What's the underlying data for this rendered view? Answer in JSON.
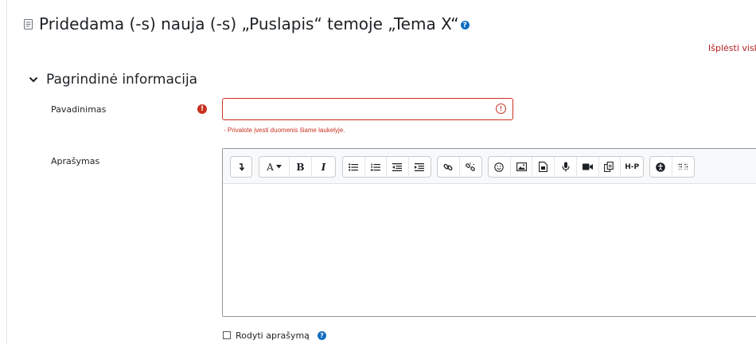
{
  "page": {
    "title": "Pridedama (-s) nauja (-s) „Puslapis“ temoje „Tema X“",
    "help_glyph": "?"
  },
  "expand_all": "Išplėsti visk",
  "section": {
    "title": "Pagrindinė informacija"
  },
  "name_field": {
    "label": "Pavadinimas",
    "required_glyph": "!",
    "value": "",
    "placeholder": "",
    "error_glyph": "!",
    "error_text": "- Privalote įvesti duomenis šiame laukelyje."
  },
  "description_field": {
    "label": "Aprašymas",
    "toolbar": {
      "text_style_label": "A",
      "bold_label": "B",
      "italic_label": "I",
      "h5p_label": "H-P"
    }
  },
  "show_description": {
    "label": "Rodyti aprašymą",
    "checked": false,
    "help_glyph": "?"
  },
  "colors": {
    "accent": "#0f6cbf",
    "error": "#ca3120",
    "expand_link": "#b91c1c"
  }
}
